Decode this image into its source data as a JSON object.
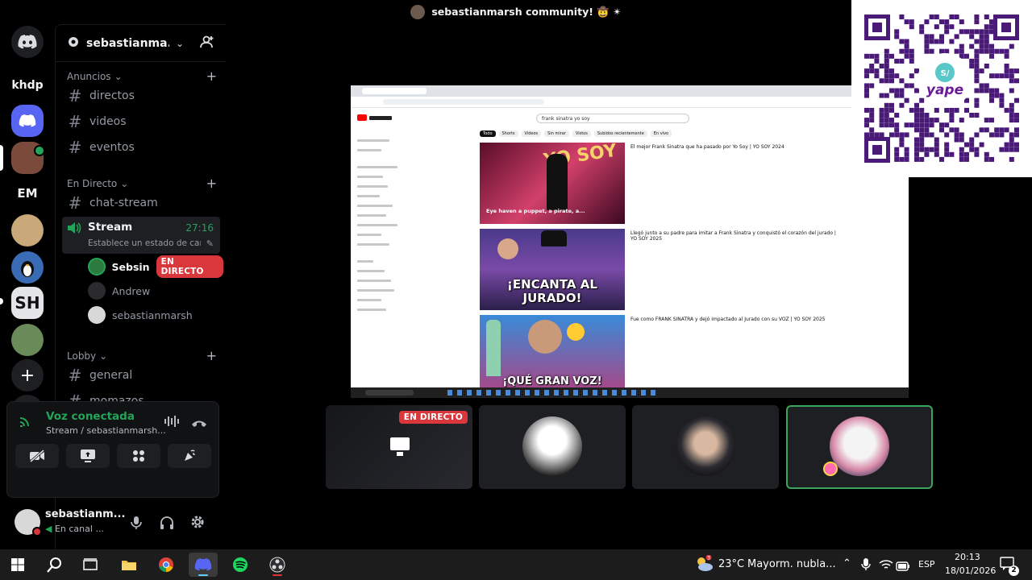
{
  "titlebar": {
    "title": "sebastianmarsh community! 🤠 ✴"
  },
  "rail": {
    "items": [
      {
        "label": "khdp"
      },
      {
        "label": "EM"
      },
      {
        "label": "SH"
      }
    ]
  },
  "server": {
    "name": "sebastianma...",
    "categories": {
      "anuncios": "Anuncios",
      "en_directo": "En Directo",
      "lobby": "Lobby"
    },
    "channels": {
      "directos": "directos",
      "videos": "videos",
      "eventos": "eventos",
      "chat_stream": "chat-stream",
      "stream": "Stream",
      "stream_timer": "27:16",
      "stream_status": "Establece un estado de can...",
      "general": "general",
      "momazos": "momazos"
    },
    "voice_users": [
      {
        "name": "Sebsin",
        "badge": "EN DIRECTO"
      },
      {
        "name": "Andrew"
      },
      {
        "name": "sebastianmarsh"
      }
    ]
  },
  "voice_panel": {
    "status": "Voz conectada",
    "location": "Stream / sebastianmarsh..."
  },
  "user_panel": {
    "name": "sebastianm...",
    "status": "En canal ..."
  },
  "stage": {
    "live_badge": "EN DIRECTO",
    "stream": {
      "search_query": "frank sinatra yo soy",
      "filters": [
        "Todo",
        "Shorts",
        "Videos",
        "Sin mirar",
        "Vistos",
        "Subidos recientemente",
        "En vivo"
      ],
      "results": [
        {
          "title": "El mejor Frank Sinatra que ha pasado por Yo Soy | YO SOY 2024",
          "thumb_text": "Eye haven a puppet, a pirate, a..."
        },
        {
          "title": "Llegó junto a su padre para imitar a Frank Sinatra y conquistó el corazón del jurado | YO SOY 2025",
          "thumb_text": "¡ENCANTA AL JURADO!"
        },
        {
          "title": "Fue como FRANK SINATRA y dejó impactado al Jurado con su VOZ | YO SOY 2025",
          "thumb_text": "¡QUÉ GRAN VOZ!"
        }
      ]
    }
  },
  "qr": {
    "brand": "yape"
  },
  "taskbar": {
    "weather_temp": "23°C",
    "weather_desc": "Mayorm. nubla...",
    "lang": "ESP",
    "time": "20:13",
    "date": "18/01/2026",
    "notif_count": "2"
  },
  "colors": {
    "live_red": "#da373c",
    "online_green": "#23a559",
    "blurple": "#5865f2",
    "speaking_border": "#3ba55c"
  }
}
